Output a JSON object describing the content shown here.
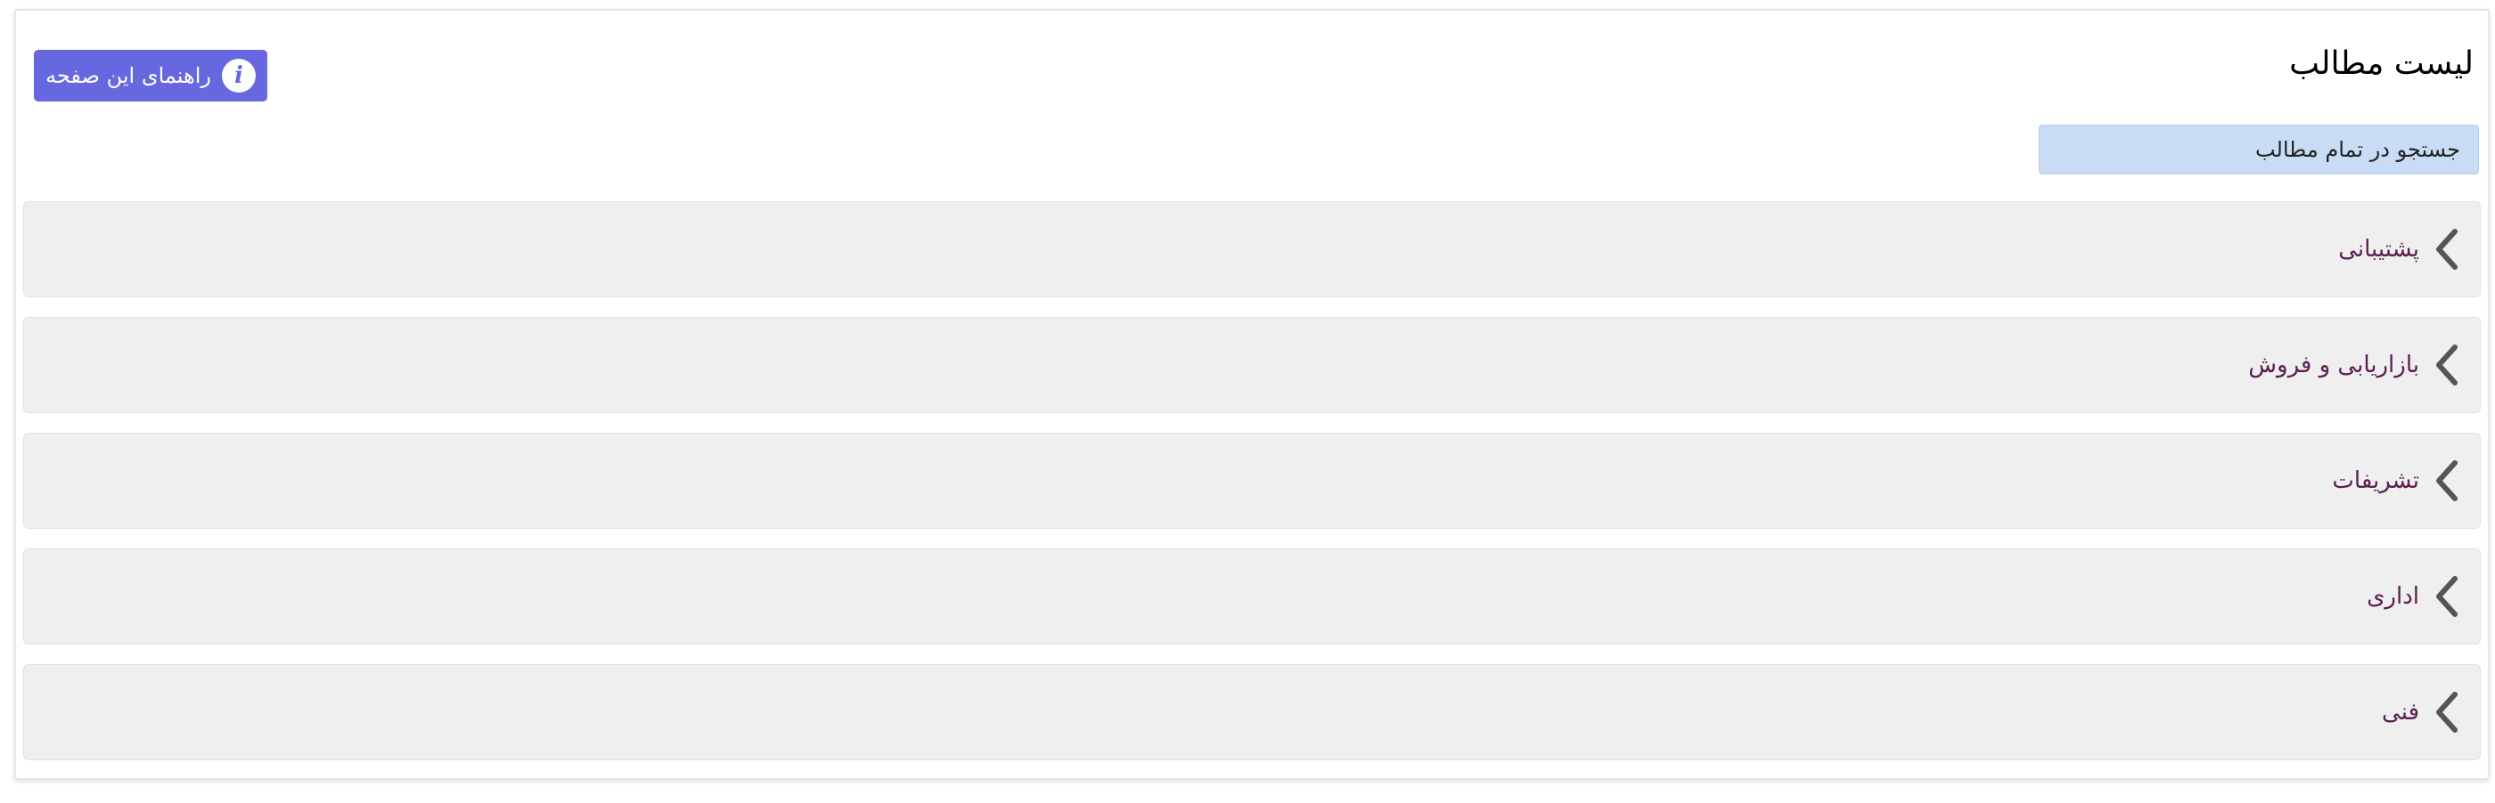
{
  "header": {
    "title": "لیست مطالب",
    "help_button_label": "راهنمای این صفحه",
    "help_icon": "info-icon"
  },
  "search": {
    "label": "جستجو در تمام مطالب"
  },
  "categories": [
    {
      "label": "پشتیبانی",
      "icon": "chevron-left-icon"
    },
    {
      "label": "بازاریابی و فروش",
      "icon": "chevron-left-icon"
    },
    {
      "label": "تشریفات",
      "icon": "chevron-left-icon"
    },
    {
      "label": "اداری",
      "icon": "chevron-left-icon"
    },
    {
      "label": "فنی",
      "icon": "chevron-left-icon"
    }
  ],
  "colors": {
    "help_button": "#6767e0",
    "search_background": "#c9dcf5",
    "category_background": "#efefef",
    "category_text": "#5c1e50",
    "chevron": "#555555"
  }
}
